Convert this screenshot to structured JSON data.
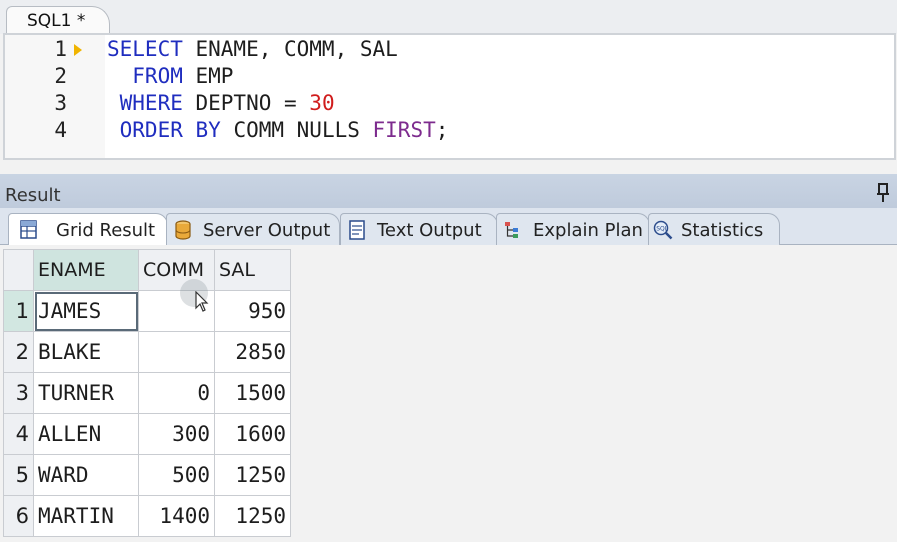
{
  "editor": {
    "tab_label": "SQL1 *",
    "line_numbers": [
      "1",
      "2",
      "3",
      "4"
    ],
    "lines": [
      [
        {
          "t": "SELECT",
          "c": "kw"
        },
        {
          "t": " ENAME, COMM, SAL",
          "c": "plain"
        }
      ],
      [
        {
          "t": "  FROM",
          "c": "kw"
        },
        {
          "t": " EMP",
          "c": "plain"
        }
      ],
      [
        {
          "t": " WHERE",
          "c": "kw"
        },
        {
          "t": " DEPTNO = ",
          "c": "plain"
        },
        {
          "t": "30",
          "c": "num"
        }
      ],
      [
        {
          "t": " ORDER BY",
          "c": "kw"
        },
        {
          "t": " COMM NULLS ",
          "c": "plain"
        },
        {
          "t": "FIRST",
          "c": "kw-purple"
        },
        {
          "t": ";",
          "c": "plain"
        }
      ]
    ]
  },
  "result_panel": {
    "title": "Result",
    "tabs": [
      {
        "label": "Grid Result",
        "icon": "grid-icon",
        "active": true
      },
      {
        "label": "Server Output",
        "icon": "database-icon",
        "active": false
      },
      {
        "label": "Text Output",
        "icon": "text-document-icon",
        "active": false
      },
      {
        "label": "Explain Plan",
        "icon": "tree-plan-icon",
        "active": false
      },
      {
        "label": "Statistics",
        "icon": "sql-magnifier-icon",
        "active": false
      }
    ]
  },
  "grid": {
    "columns": [
      "ENAME",
      "COMM",
      "SAL"
    ],
    "rows": [
      {
        "num": "1",
        "ename": "JAMES",
        "comm": "",
        "sal": "950"
      },
      {
        "num": "2",
        "ename": "BLAKE",
        "comm": "",
        "sal": "2850"
      },
      {
        "num": "3",
        "ename": "TURNER",
        "comm": "0",
        "sal": "1500"
      },
      {
        "num": "4",
        "ename": "ALLEN",
        "comm": "300",
        "sal": "1600"
      },
      {
        "num": "5",
        "ename": "WARD",
        "comm": "500",
        "sal": "1250"
      },
      {
        "num": "6",
        "ename": "MARTIN",
        "comm": "1400",
        "sal": "1250"
      }
    ]
  },
  "colors": {
    "keyword": "#1f2dbf",
    "keyword_purple": "#7d2b8e",
    "number": "#d01c1c",
    "sorted_header": "#cfe4df",
    "panel_header": "#c9d4e3"
  }
}
